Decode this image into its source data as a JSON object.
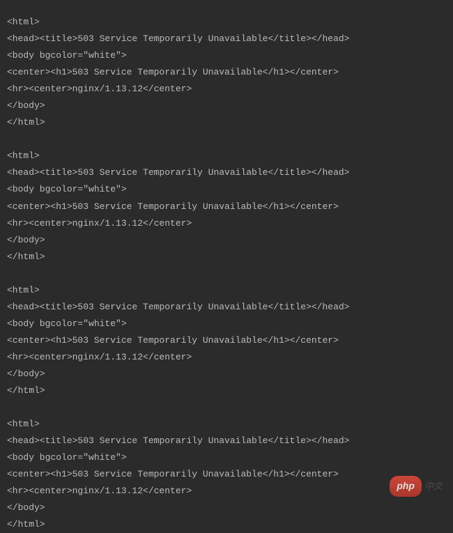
{
  "code": {
    "blocks": [
      {
        "lines": [
          "<html>",
          "<head><title>503 Service Temporarily Unavailable</title></head>",
          "<body bgcolor=\"white\">",
          "<center><h1>503 Service Temporarily Unavailable</h1></center>",
          "<hr><center>nginx/1.13.12</center>",
          "</body>",
          "</html>"
        ]
      },
      {
        "lines": [
          "<html>",
          "<head><title>503 Service Temporarily Unavailable</title></head>",
          "<body bgcolor=\"white\">",
          "<center><h1>503 Service Temporarily Unavailable</h1></center>",
          "<hr><center>nginx/1.13.12</center>",
          "</body>",
          "</html>"
        ]
      },
      {
        "lines": [
          "<html>",
          "<head><title>503 Service Temporarily Unavailable</title></head>",
          "<body bgcolor=\"white\">",
          "<center><h1>503 Service Temporarily Unavailable</h1></center>",
          "<hr><center>nginx/1.13.12</center>",
          "</body>",
          "</html>"
        ]
      },
      {
        "lines": [
          "<html>",
          "<head><title>503 Service Temporarily Unavailable</title></head>",
          "<body bgcolor=\"white\">",
          "<center><h1>503 Service Temporarily Unavailable</h1></center>",
          "<hr><center>nginx/1.13.12</center>",
          "</body>",
          "</html>"
        ]
      }
    ]
  },
  "watermark": {
    "brand": "php",
    "suffix": "中文"
  }
}
